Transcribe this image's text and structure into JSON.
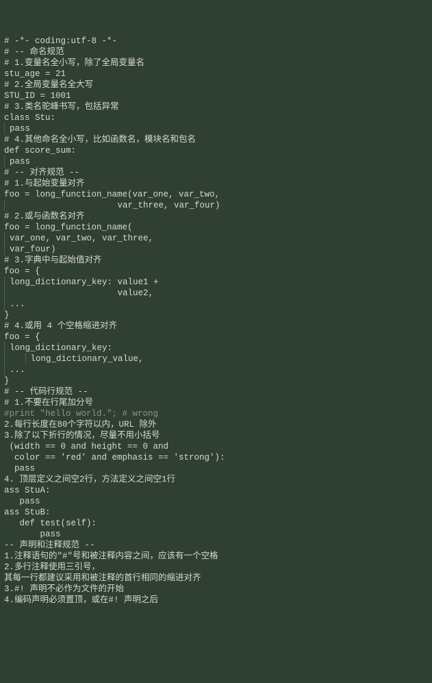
{
  "lines": [
    "# -*- coding:utf-8 -*-",
    "# -- 命名规范",
    "# 1.变量名全小写，除了全局变量名",
    "stu_age = 21",
    "# 2.全局变量名全大写",
    "STU_ID = 1001",
    "# 3.类名驼峰书写，包括异常",
    "class Stu:",
    "    pass",
    "# 4.其他命名全小写，比如函数名，模块名和包名",
    "def score_sum:",
    "    pass",
    "",
    "# -- 对齐规范 --",
    "# 1.与起始变量对齐",
    "foo = long_function_name(var_one, var_two,",
    "                         var_three, var_four)",
    "# 2.或与函数名对齐",
    "foo = long_function_name(",
    "    var_one, var_two, var_three,",
    "    var_four)",
    "",
    "# 3.字典中与起始值对齐",
    "foo = {",
    "    long_dictionary_key: value1 +",
    "                         value2,",
    "    ...",
    "}",
    "",
    "# 4.或用 4 个空格缩进对齐",
    "foo = {",
    "    long_dictionary_key:",
    "        long_dictionary_value,",
    "    ...",
    "}",
    "",
    "# -- 代码行规范 --",
    "# 1.不要在行尾加分号",
    "#print \"hello world.\"; # wrong",
    "2.每行长度在80个字符以内，URL 除外",
    "3.除了以下折行的情况，尽量不用小括号",
    " (width == 0 and height == 0 and",
    "  color == 'red' and emphasis == 'strong'):",
    "  pass",
    "4. 顶层定义之间空2行，方法定义之间空1行",
    "ass StuA:",
    "   pass",
    "",
    "",
    "ass StuB:",
    "   def test(self):",
    "       pass",
    "",
    "-- 声明和注释规范 --",
    "1.注释语句的\"#\"号和被注释内容之间，应该有一个空格",
    "",
    "2.多行注释使用三引号，",
    "其每一行都建议采用和被注释的首行相同的缩进对齐",
    "",
    "3.#! 声明不必作为文件的开始",
    "4.编码声明必须置顶，或在#! 声明之后"
  ],
  "guideIndexes": [
    8,
    11,
    16,
    19,
    20,
    24,
    25,
    26,
    31,
    32,
    33
  ],
  "guideL2Indexes": [
    32
  ],
  "mutedIndex": 38
}
